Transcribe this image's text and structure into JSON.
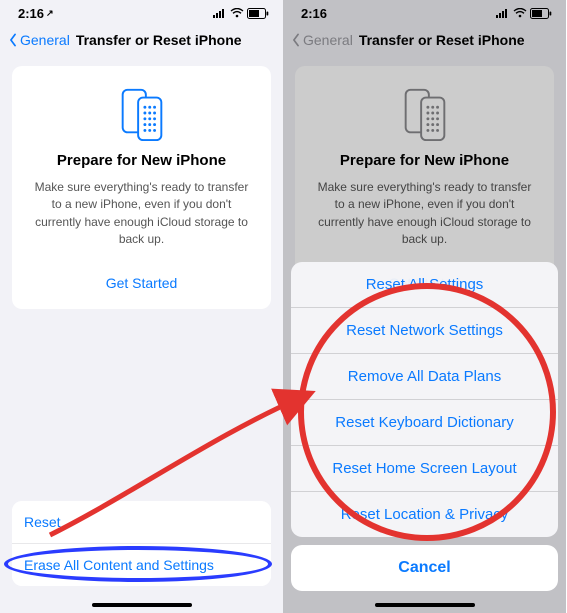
{
  "status": {
    "time": "2:16",
    "carrier_arrow": "↗"
  },
  "nav": {
    "back_label": "General",
    "title": "Transfer or Reset iPhone"
  },
  "card": {
    "heading": "Prepare for New iPhone",
    "body": "Make sure everything's ready to transfer to a new iPhone, even if you don't currently have enough iCloud storage to back up.",
    "cta": "Get Started"
  },
  "left_list": {
    "reset": "Reset",
    "erase": "Erase All Content and Settings"
  },
  "sheet": {
    "items": [
      "Reset All Settings",
      "Reset Network Settings",
      "Remove All Data Plans",
      "Reset Keyboard Dictionary",
      "Reset Home Screen Layout",
      "Reset Location & Privacy"
    ],
    "cancel": "Cancel"
  },
  "colors": {
    "accent": "#0a7aff",
    "annotation_red": "#e3332f",
    "annotation_blue": "#2a3cff"
  }
}
